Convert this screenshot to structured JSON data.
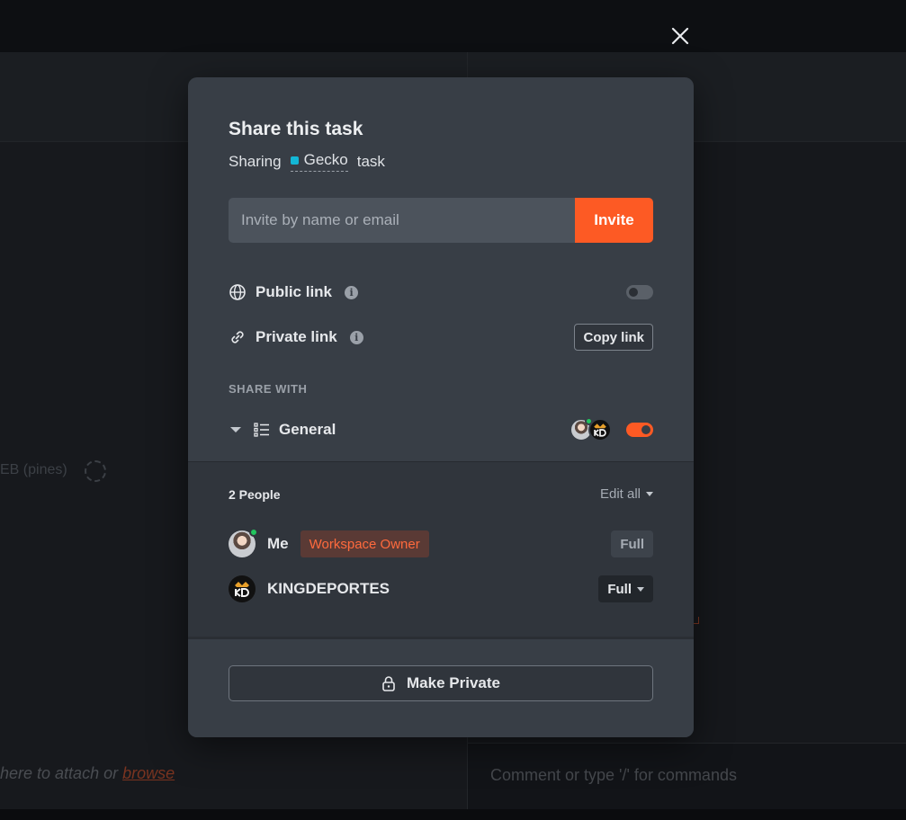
{
  "background": {
    "faded_label": "EB (pines)",
    "attach_prefix": "here to attach or ",
    "attach_link": "browse",
    "comment_placeholder": "Comment or type '/' for commands"
  },
  "modal": {
    "title": "Share this task",
    "subtitle_prefix": "Sharing",
    "task_name": "Gecko",
    "subtitle_suffix": "task",
    "task_color": "#13b7d6",
    "invite": {
      "placeholder": "Invite by name or email",
      "button_label": "Invite"
    },
    "public_link": {
      "label": "Public link",
      "icon": "globe-icon",
      "enabled": false
    },
    "private_link": {
      "label": "Private link",
      "icon": "link-icon",
      "button_label": "Copy link"
    },
    "share_with": {
      "label": "SHARE WITH",
      "list_name": "General",
      "list_icon": "list-icon",
      "enabled": true,
      "avatars": [
        "me-avatar",
        "kingdeportes-avatar"
      ]
    },
    "people": {
      "count_label": "2 People",
      "edit_all_label": "Edit all",
      "members": [
        {
          "name": "Me",
          "badge": "Workspace Owner",
          "permission": "Full",
          "online": true
        },
        {
          "name": "KINGDEPORTES",
          "badge": "",
          "permission": "Full",
          "online": false
        }
      ]
    },
    "make_private_label": "Make Private"
  },
  "colors": {
    "accent": "#fd5a24",
    "modal_bg": "#383e46",
    "online": "#22c55e"
  }
}
